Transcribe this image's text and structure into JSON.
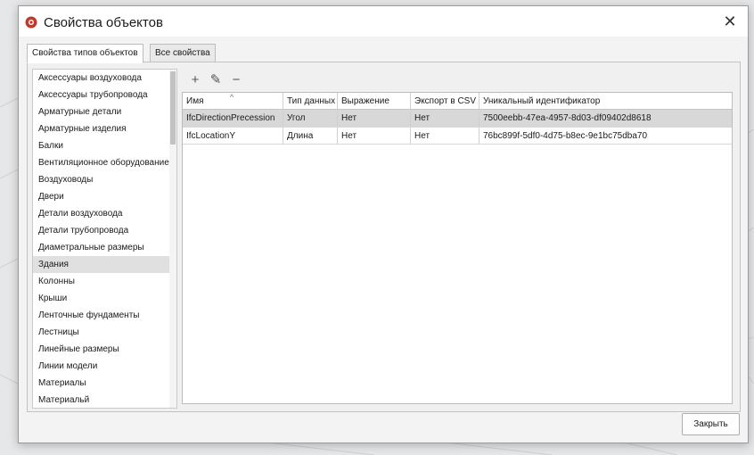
{
  "window": {
    "title": "Свойства объектов",
    "close_glyph": "✕"
  },
  "tabs": [
    {
      "label": "Свойства типов объектов",
      "active": true
    },
    {
      "label": "Все свойства",
      "active": false
    }
  ],
  "object_types": [
    "Аксессуары воздуховода",
    "Аксессуары трубопровода",
    "Арматурные детали",
    "Арматурные изделия",
    "Балки",
    "Вентиляционное оборудование",
    "Воздуховоды",
    "Двери",
    "Детали воздуховода",
    "Детали трубопровода",
    "Диаметральные размеры",
    "Здания",
    "Колонны",
    "Крыши",
    "Ленточные фундаменты",
    "Лестницы",
    "Линейные размеры",
    "Линии модели",
    "Материалы",
    "Материальй"
  ],
  "selected_object_type": "Здания",
  "toolbar": {
    "add_glyph": "+",
    "edit_glyph": "✎",
    "remove_glyph": "−"
  },
  "table": {
    "columns": [
      "Имя",
      "Тип данных",
      "Выражение",
      "Экспорт в CSV",
      "Уникальный идентификатор"
    ],
    "sort_glyph": "^",
    "rows": [
      [
        "IfcDirectionPrecession",
        "Угол",
        "Нет",
        "Нет",
        "7500eebb-47ea-4957-8d03-df09402d8618"
      ],
      [
        "IfcLocationY",
        "Длина",
        "Нет",
        "Нет",
        "76bc899f-5df0-4d75-b8ec-9e1bc75dba70"
      ]
    ]
  },
  "buttons": {
    "close": "Закрыть"
  },
  "colors": {
    "selection": "#d8d8d8",
    "app_icon": "#c0392b"
  }
}
